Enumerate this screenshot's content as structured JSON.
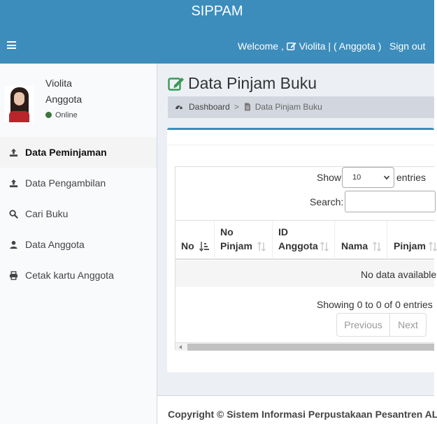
{
  "header": {
    "brand": "SIPPAM",
    "welcome_prefix": "Welcome ,",
    "welcome_user": "Violita | ( Anggota )",
    "signout_label": "Sign out"
  },
  "user_panel": {
    "name": "Violita",
    "role": "Anggota",
    "status": "Online"
  },
  "sidebar": {
    "items": [
      {
        "label": "Data Peminjaman",
        "icon": "upload-icon",
        "active": true
      },
      {
        "label": "Data Pengambilan",
        "icon": "upload-icon",
        "active": false
      },
      {
        "label": "Cari Buku",
        "icon": "search-icon",
        "active": false
      },
      {
        "label": "Data Anggota",
        "icon": "user-icon",
        "active": false
      },
      {
        "label": "Cetak kartu Anggota",
        "icon": "print-icon",
        "active": false
      }
    ]
  },
  "page": {
    "title": "Data Pinjam Buku",
    "title_icon": "edit-icon",
    "breadcrumb_home": "Dashboard",
    "breadcrumb_sep": ">",
    "breadcrumb_current": "Data Pinjam Buku"
  },
  "datatable": {
    "show_label": "Show",
    "length_value": "10",
    "entries_label": "entries",
    "search_label": "Search:",
    "search_value": "",
    "columns": [
      "No",
      "No\nPinjam",
      "ID\nAnggota",
      "Nama",
      "Pinjam"
    ],
    "empty_message": "No data available",
    "info": "Showing 0 to 0 of 0 entries",
    "prev_label": "Previous",
    "next_label": "Next"
  },
  "footer": {
    "copyright": "Copyright © Sistem Informasi Perpustakaan Pesantren AL Mut"
  },
  "colors": {
    "header": "#3c8dbc",
    "accent": "#3c8dbc",
    "online": "#3c763d",
    "title_icon": "#3a9a5a"
  }
}
